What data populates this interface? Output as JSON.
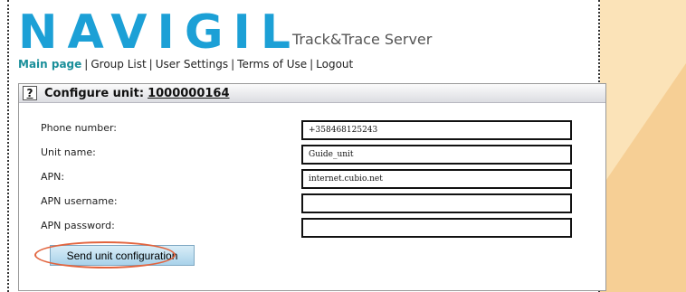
{
  "branding": {
    "logo_text": "NAVIGIL",
    "subtitle": "Track&Trace Server"
  },
  "nav": {
    "items": [
      "Main page",
      "Group List",
      "User Settings",
      "Terms of Use",
      "Logout"
    ],
    "separator": "|"
  },
  "config": {
    "help_label": "?",
    "title": "Configure unit:",
    "unit_id": "1000000164",
    "fields": [
      {
        "label": "Phone number:",
        "value": "+358468125243"
      },
      {
        "label": "Unit name:",
        "value": "Guide_unit"
      },
      {
        "label": "APN:",
        "value": "internet.cubio.net"
      },
      {
        "label": "APN username:",
        "value": ""
      },
      {
        "label": "APN password:",
        "value": ""
      }
    ],
    "send_label": "Send unit configuration"
  },
  "colors": {
    "logo": "#1ca0d6",
    "active_link": "#1a8f9a",
    "highlight": "#e2643e",
    "background_accent": "#fbe3b8"
  }
}
